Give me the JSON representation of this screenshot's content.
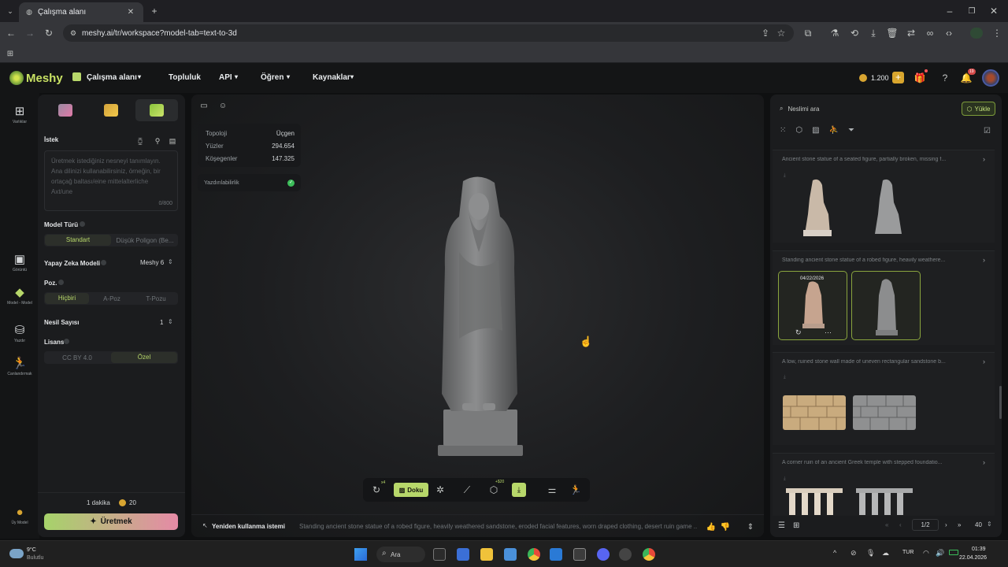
{
  "browser": {
    "tab_title": "Çalışma alanı",
    "url": "meshy.ai/tr/workspace?model-tab=text-to-3d"
  },
  "header": {
    "logo": "Meshy",
    "nav": [
      "Çalışma alanı",
      "Topluluk",
      "API",
      "Öğren",
      "Kaynaklar"
    ],
    "credits": "1.200",
    "notif_count": "19"
  },
  "rail": {
    "items": [
      "Varlıklar",
      "Görüntü",
      "Model - Model",
      "Yazdır",
      "Canlandırmak",
      "Üy Model"
    ]
  },
  "left_panel": {
    "prompt_label": "İstek",
    "prompt_placeholder": "Üretmek istediğiniz nesneyi tanımlayın. Ana dilinizi kullanabilirsiniz, örneğin, bir ortaçağ baltası/eine mittelalterliche Axt/une",
    "prompt_count": "0/800",
    "model_type_label": "Model Türü",
    "model_type_options": [
      "Standart",
      "Düşük Poligon (Be..."
    ],
    "ai_model_label": "Yapay Zeka Modeli",
    "ai_model_value": "Meshy 6",
    "pose_label": "Poz.",
    "pose_options": [
      "Hiçbiri",
      "A-Poz",
      "T-Pozu"
    ],
    "gen_count_label": "Nesil Sayısı",
    "gen_count_value": "1",
    "license_label": "Lisans",
    "license_options": [
      "CC BY 4.0",
      "Özel"
    ],
    "time_label": "1 dakika",
    "cost": "20",
    "generate_label": "Üretmek"
  },
  "viewer": {
    "stats": [
      {
        "k": "Topoloji",
        "v": "Üçgen"
      },
      {
        "k": "Yüzler",
        "v": "294.654"
      },
      {
        "k": "Köşegenler",
        "v": "147.325"
      }
    ],
    "printable_label": "Yazdırılabilirlik",
    "texture_label": "Doku",
    "reuse_label": "Yeniden kullanma istemi",
    "prompt_preview": "Standing ancient stone statue of a robed figure, heavily weathered sandstone, eroded facial features, worn draped clothing, desert ruin game ...",
    "toolbar_badge1": "x4",
    "toolbar_badge2": "+$20"
  },
  "right_panel": {
    "search_placeholder": "Neslimi ara",
    "upload_label": "Yükle",
    "groups": [
      {
        "title": "Ancient stone statue of a seated figure, partially broken, missing f..."
      },
      {
        "title": "Standing ancient stone statue of a robed figure, heavily weathere...",
        "date": "04/22/2026"
      },
      {
        "title": "A low, ruined stone wall made of uneven rectangular sandstone b..."
      },
      {
        "title": "A corner ruin of an ancient Greek temple with stepped foundatio..."
      }
    ],
    "page": "1/2",
    "per_page": "40"
  },
  "taskbar": {
    "weather_temp": "9°C",
    "weather_desc": "Bulutlu",
    "search_label": "Ara",
    "lang": "TUR",
    "time": "01:39",
    "date": "22.04.2026"
  },
  "colors": {
    "accent": "#b7d76a",
    "generate_gradient_start": "#a6d36a",
    "generate_gradient_end": "#e58aa6"
  }
}
